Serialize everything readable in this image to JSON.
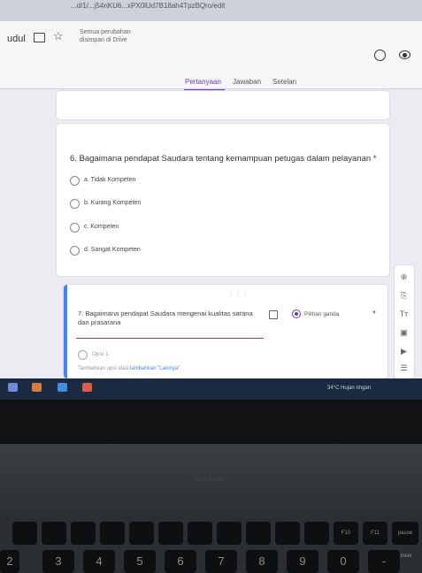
{
  "browser": {
    "url": "...d/1/...j54nKU6...xPX0lUd7B18ah4TpzBQro/edit"
  },
  "header": {
    "doc_title": "udul",
    "save_status_line1": "Semua perubahan",
    "save_status_line2": "disimpan di Drive",
    "tabs": [
      "Pertanyaan",
      "Jawaban",
      "Setelan"
    ],
    "active_tab": "Pertanyaan"
  },
  "question6": {
    "title": "6. Bagaimana pendapat Saudara tentang kemampuan petugas dalam pelayanan *",
    "options": [
      "a. Tidak Kompeten",
      "b. Kurang Kompeten",
      "c. Kompeten",
      "d. Sangat Kompeten"
    ]
  },
  "question7": {
    "title": "7. Bagaimana pendapat Saudara mengenai kualitas sarana dan prasarana",
    "type_label": "Pilihan ganda",
    "option1": "Opsi 1",
    "add_option_text": "Tambahkan opsi atau",
    "add_other_link": "tambahkan \"Lainnya\""
  },
  "toolbar_icons": [
    "add-question-icon",
    "import-questions-icon",
    "add-title-icon",
    "add-image-icon",
    "add-video-icon",
    "add-section-icon"
  ],
  "taskbar": {
    "weather": "34°C Hujan ringan"
  },
  "laptop": {
    "brand": "VivoBook"
  },
  "keyboard": {
    "fn_row": [
      "",
      "",
      "",
      "",
      "",
      "",
      "",
      "",
      "",
      "",
      "",
      "F10",
      "F11",
      "pause break"
    ],
    "num_row": [
      "2",
      "3",
      "4",
      "5",
      "6",
      "7",
      "8",
      "9",
      "0",
      "-"
    ]
  }
}
